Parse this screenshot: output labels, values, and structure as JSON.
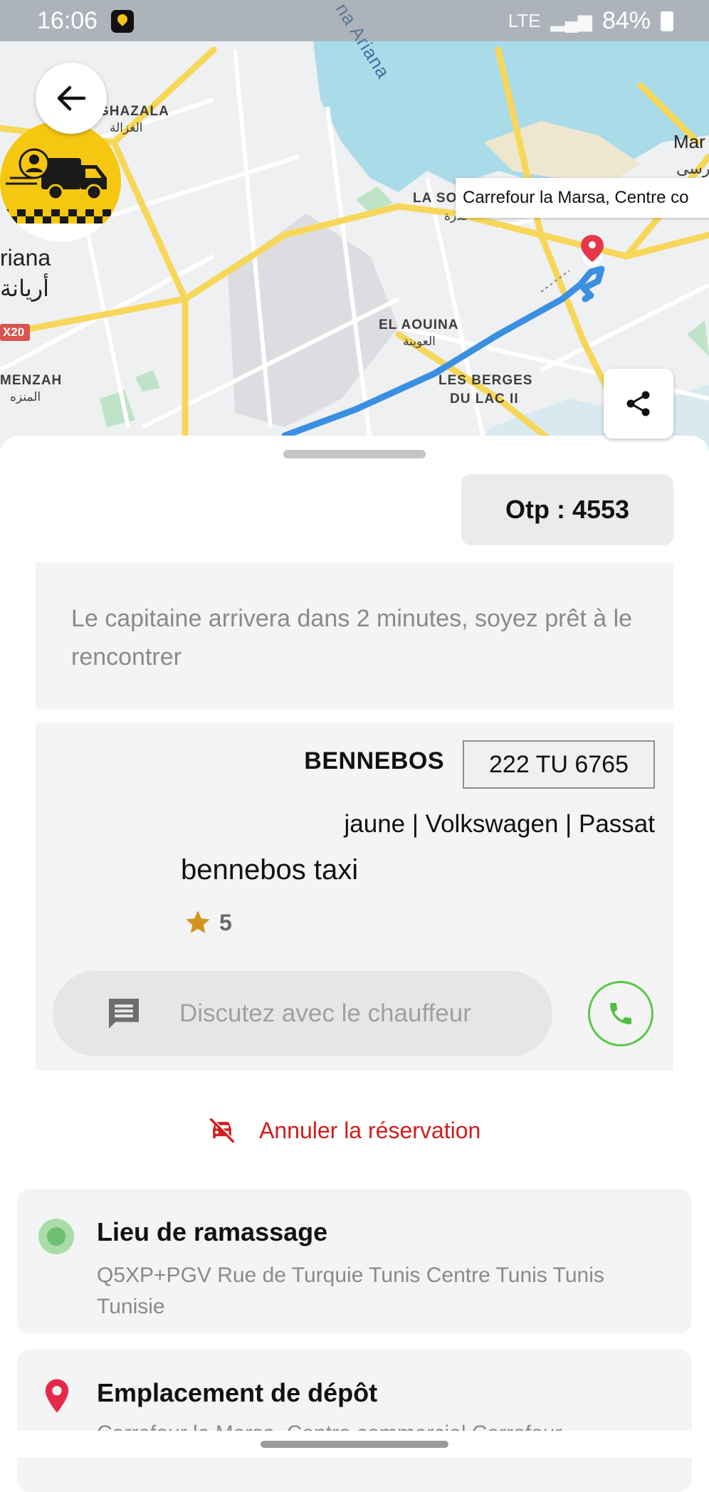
{
  "status_bar": {
    "time": "16:06",
    "battery": "84%",
    "network": "LTE"
  },
  "map": {
    "labels": {
      "ghazala": "GHAZALA",
      "ghazala_ar": "الغزالة",
      "ariana": "riana",
      "ariana_ar": "أريانة",
      "lake": "na Ariana",
      "road": "X20",
      "menzah": "MENZAH",
      "menzah_ar": "المنزه",
      "aouina": "EL AOUINA",
      "aouina_ar": "العوينة",
      "berges_1": "LES BERGES",
      "berges_2": "DU LAC II",
      "lasoukra": "LA SO",
      "lasoukra_ar": "ـدرة",
      "marsa": "Mar",
      "marsa_ar": "رسى"
    },
    "destination_tooltip": "Carrefour la Marsa, Centre co",
    "route_color": "#3b8fe0"
  },
  "otp": {
    "label": "Otp : 4553"
  },
  "arrival_message": "Le capitaine arrivera dans 2 minutes, soyez prêt à le rencontrer",
  "driver": {
    "name": "BENNEBOS",
    "plate": "222 TU 6765",
    "vehicle": "jaune | Volkswagen | Passat",
    "company": "bennebos taxi",
    "rating": "5",
    "chat_placeholder": "Discutez avec le chauffeur"
  },
  "cancel_label": "Annuler la réservation",
  "pickup": {
    "title": "Lieu de ramassage",
    "address": "Q5XP+PGV Rue de Turquie Tunis Centre Tunis Tunis Tunisie"
  },
  "dropoff": {
    "title": "Emplacement de dépôt",
    "address": "Carrefour la Marsa, Centre commercial Carrefour,"
  },
  "colors": {
    "accent_yellow": "#f5c711",
    "cancel_red": "#d11d1d",
    "call_green": "#59c749",
    "star": "#d4921f",
    "pin_red": "#e5294a"
  },
  "icons": [
    "back-arrow-icon",
    "share-icon",
    "chat-icon",
    "phone-icon",
    "cancel-car-icon",
    "star-icon",
    "pickup-dot-icon",
    "location-pin-icon"
  ]
}
